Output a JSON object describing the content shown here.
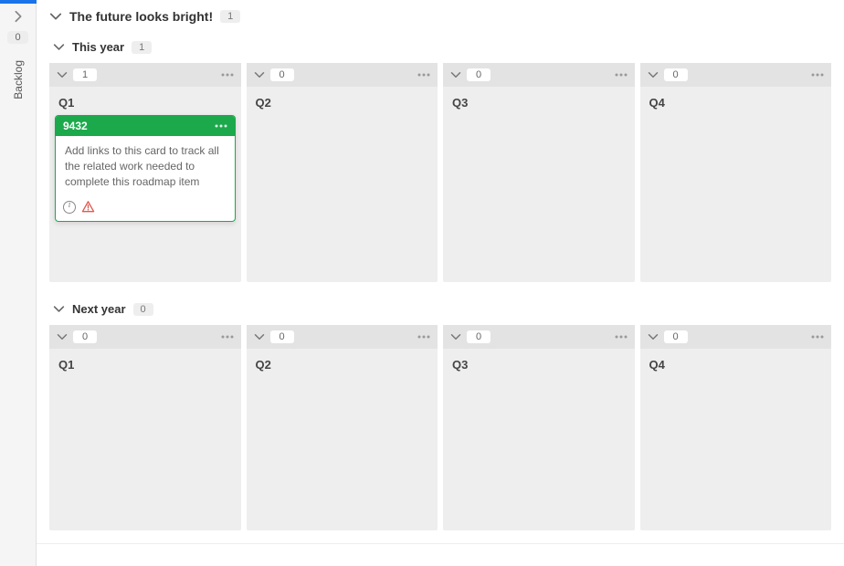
{
  "sidebar": {
    "count": "0",
    "label": "Backlog"
  },
  "board": {
    "title": "The future looks bright!",
    "count": "1",
    "swimlanes": [
      {
        "title": "This year",
        "count": "1",
        "columns": [
          {
            "title": "Q1",
            "count": "1"
          },
          {
            "title": "Q2",
            "count": "0"
          },
          {
            "title": "Q3",
            "count": "0"
          },
          {
            "title": "Q4",
            "count": "0"
          }
        ]
      },
      {
        "title": "Next year",
        "count": "0",
        "columns": [
          {
            "title": "Q1",
            "count": "0"
          },
          {
            "title": "Q2",
            "count": "0"
          },
          {
            "title": "Q3",
            "count": "0"
          },
          {
            "title": "Q4",
            "count": "0"
          }
        ]
      }
    ]
  },
  "card": {
    "id": "9432",
    "text": "Add links to this card to track all the related work needed to complete this roadmap item"
  },
  "colors": {
    "accent": "#1a73e8",
    "card_green": "#1ba94c",
    "warn": "#e05a4f"
  }
}
